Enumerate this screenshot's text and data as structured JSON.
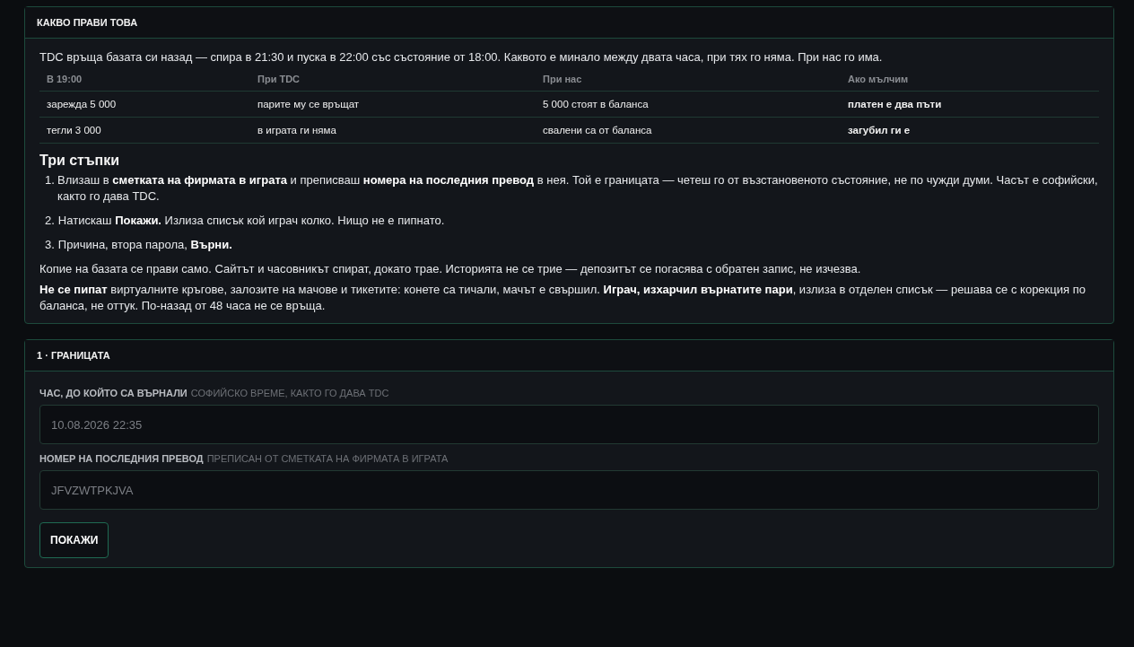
{
  "info_panel": {
    "title": "КАКВО ПРАВИ ТОВА",
    "intro": "TDC връща базата си назад — спира в 21:30 и пуска в 22:00 със състояние от 18:00. Каквото е минало между двата часа, при тях го няма. При нас го има.",
    "table": {
      "columns": [
        "В 19:00",
        "При TDC",
        "При нас",
        "Ако мълчим"
      ],
      "rows": [
        [
          "зарежда 5 000",
          "парите му се връщат",
          "5 000 стоят в баланса",
          "платен е два пъти"
        ],
        [
          "тегли 3 000",
          "в играта ги няма",
          "свалени са от баланса",
          "загубил ги е"
        ]
      ]
    },
    "steps_title": "Три стъпки",
    "steps": [
      {
        "number": "1.",
        "text": "Влизаш в **сметката на фирмата в играта** и преписваш **номера на последния превод** в нея. Той е границата — четеш го от възстановеното състояние, не по чужди думи. Часът е софийски, както го дава TDC."
      },
      {
        "number": "2.",
        "text": "Натискаш **Покажи.** Излиза списък кой играч колко. Нищо не е пипнато."
      },
      {
        "number": "3.",
        "text": "Причина, втора парола, **Върни.**"
      }
    ],
    "notes": [
      "Копие на базата се прави само. Сайтът и часовникът спират, докато трае. Историята не се трие — депозитът се погасява с обратен запис, не изчезва.",
      "**Не се пипат** виртуалните кръгове, залозите на мачове и тикетите: конете са тичали, мачът е свършил. **Играч, изхарчил върнатите пари**, излиза в отделен списък — решава се с корекция по баланса, не оттук. По-назад от 48 часа не се връща."
    ]
  },
  "boundary_panel": {
    "title": "1 · ГРАНИЦАТА",
    "fields": [
      {
        "label": "ЧАС, ДО КОЙТО СА ВЪРНАЛИ",
        "hint": "СОФИЙСКО ВРЕМЕ, КАКТО ГО ДАВА TDC",
        "placeholder": "10.08.2026 22:35"
      },
      {
        "label": "НОМЕР НА ПОСЛЕДНИЯ ПРЕВОД",
        "hint": "ПРЕПИСАН ОТ СМЕТКАТА НА ФИРМАТА В ИГРАТА",
        "placeholder": "JFVZWTPKJVA"
      }
    ],
    "button": "ПОКАЖИ"
  }
}
